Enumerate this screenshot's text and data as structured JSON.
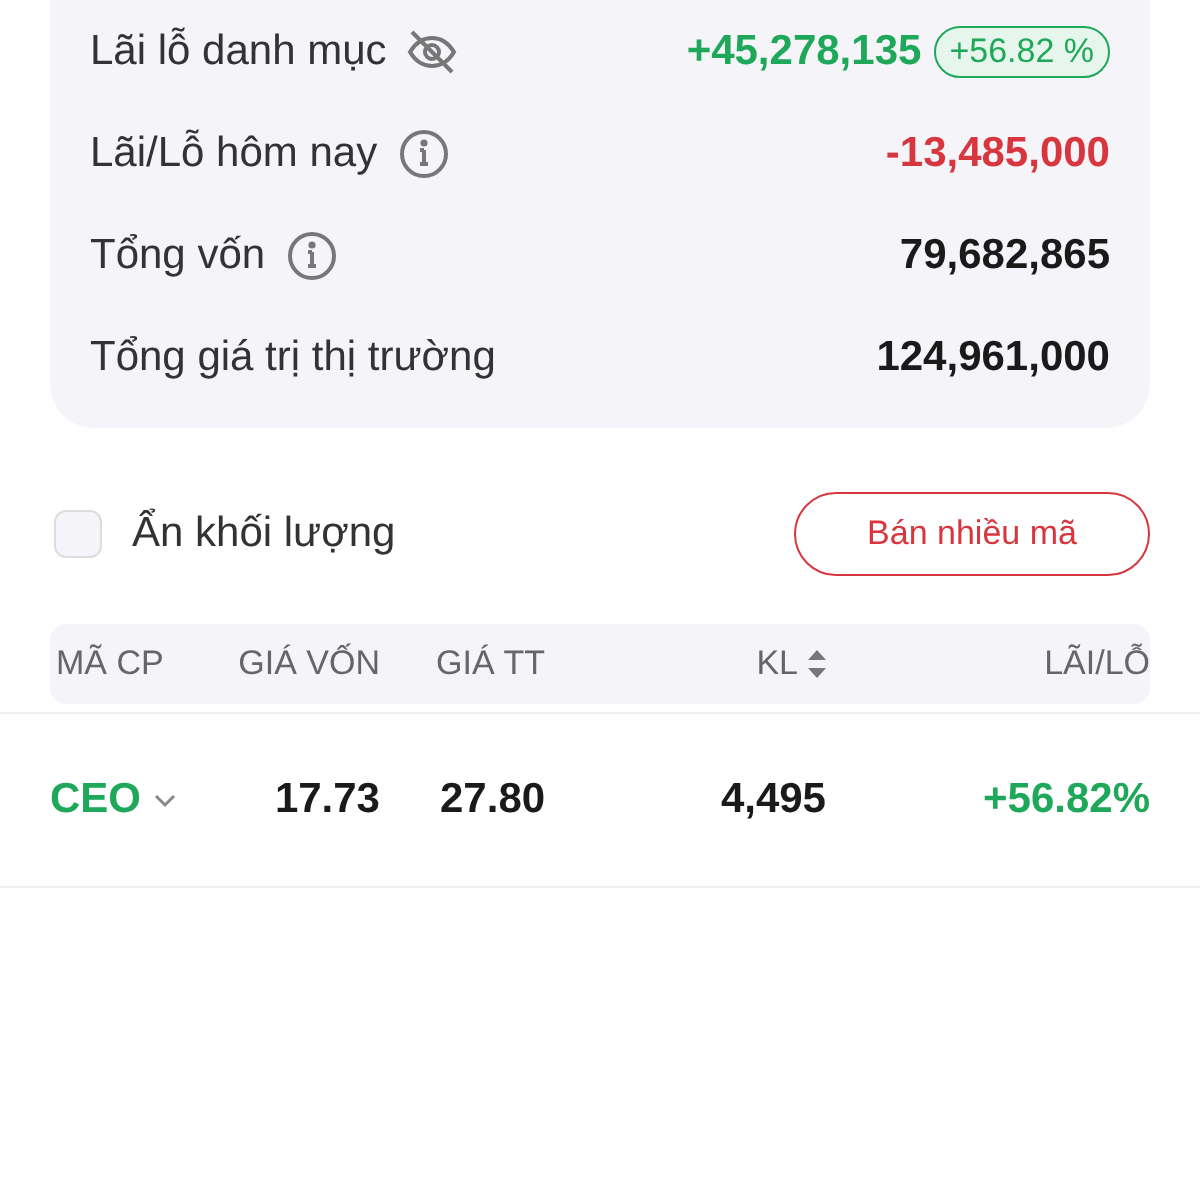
{
  "summary": [
    {
      "label": "Lãi lỗ danh mục",
      "kind": "toggle",
      "value": "+45,278,135",
      "color": "#1fa85a",
      "badge": "+56.82 %"
    },
    {
      "label": "Lãi/Lỗ hôm nay",
      "kind": "info",
      "value": "-13,485,000",
      "color": "#d8363f"
    },
    {
      "label": "Tổng vốn",
      "kind": "info",
      "value": "79,682,865",
      "color": "#1a1a1a"
    },
    {
      "label": "Tổng giá trị thị trường",
      "kind": "plain",
      "value": "124,961,000",
      "color": "#1a1a1a"
    }
  ],
  "hide_volume": {
    "label": "Ẩn khối lượng",
    "checked": false
  },
  "sell_button": "Bán nhiều mã",
  "table": {
    "columns": [
      {
        "label": "MÃ CP",
        "sortable": false
      },
      {
        "label": "GIÁ VỐN",
        "sortable": false
      },
      {
        "label": "GIÁ TT",
        "sortable": false
      },
      {
        "label": "KL",
        "sortable": true
      },
      {
        "label": "LÃI/LỖ",
        "sortable": false
      }
    ],
    "rows": [
      {
        "symbol": "CEO",
        "cost": "17.73",
        "price": "27.80",
        "volume": "4,495",
        "pnl": "+56.82%",
        "color": "#1fa85a"
      }
    ]
  }
}
